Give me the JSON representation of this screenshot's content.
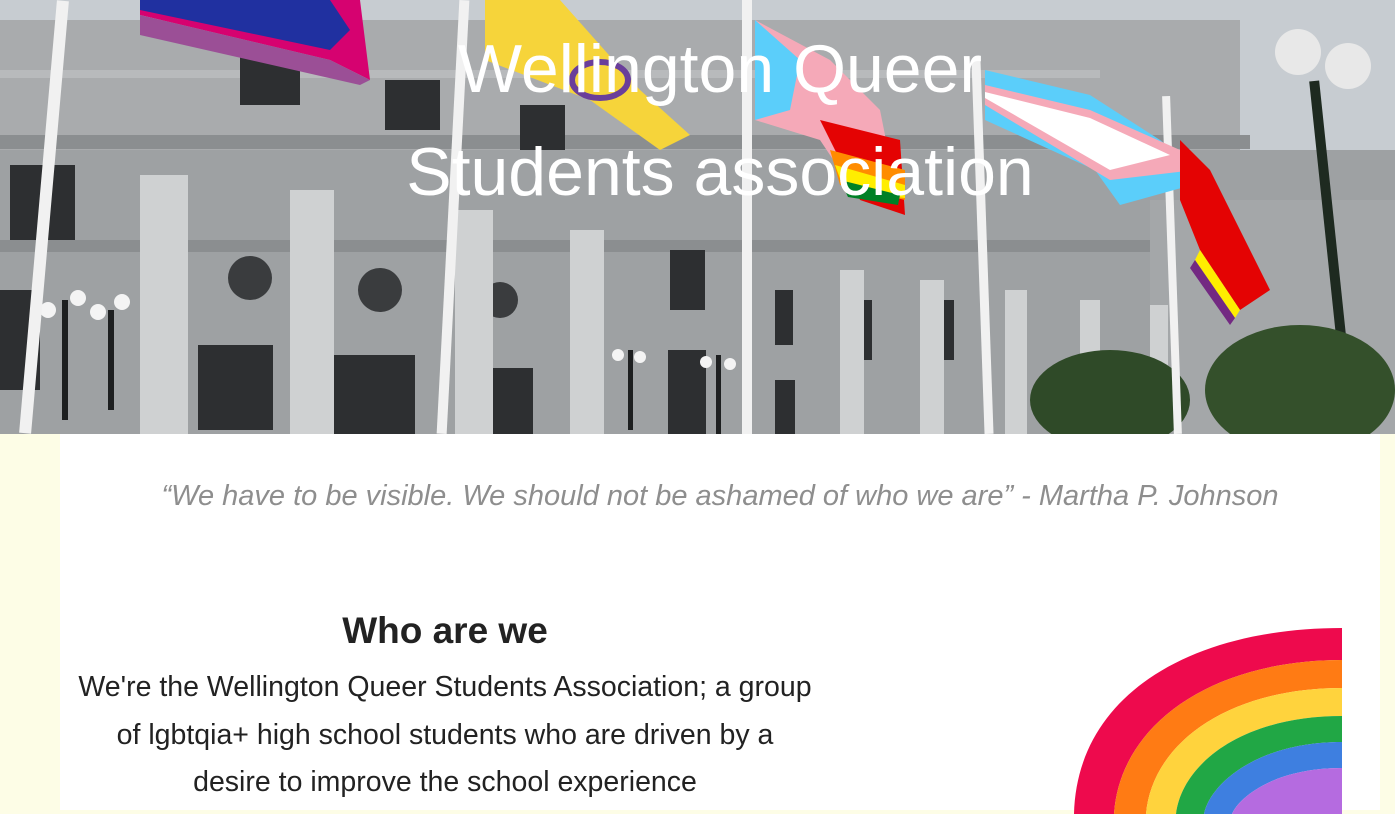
{
  "hero": {
    "title_line1": "Wellington Queer",
    "title_line2": "Students association",
    "image_icon": "parliament-building-with-pride-flags"
  },
  "quote": {
    "text": "“We have to be visible. We should not be ashamed of who we are” - Martha P. Johnson"
  },
  "about": {
    "heading": "Who are we",
    "body": "We're the Wellington Queer Students Association; a group of lgbtqia+ high school students who are driven by a desire to improve the school experience"
  },
  "colors": {
    "page_background": "#fdfde6",
    "content_background": "#ffffff",
    "quote_text": "#8e8e8e",
    "rainbow": [
      "#ee0a4d",
      "#ff7b14",
      "#ffd33d",
      "#21a745",
      "#3e7fe0",
      "#b56be0"
    ]
  },
  "rainbow_icon": "rainbow-icon"
}
